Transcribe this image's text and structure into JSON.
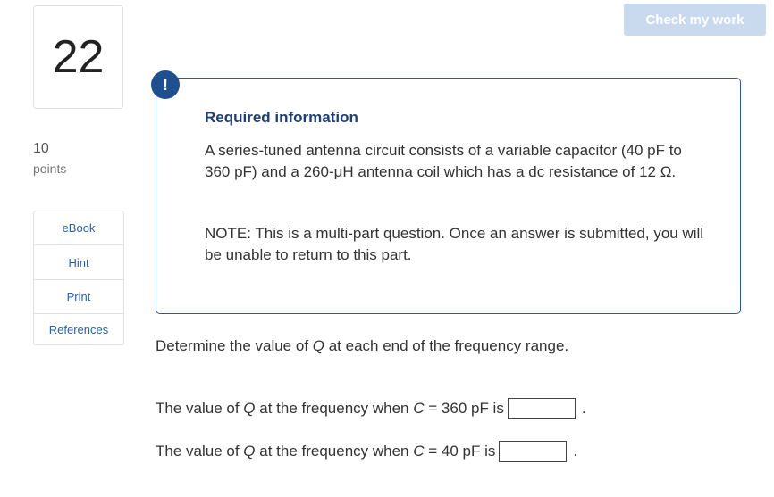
{
  "question": {
    "number": "22",
    "points_value": "10",
    "points_label": "points"
  },
  "tools": [
    {
      "label": "eBook"
    },
    {
      "label": "Hint"
    },
    {
      "label": "Print"
    },
    {
      "label": "References"
    }
  ],
  "header": {
    "check_button": "Check my work"
  },
  "info": {
    "icon": "!",
    "title": "Required information",
    "text": "A series-tuned antenna circuit consists of a variable capacitor (40 pF to 360 pF) and a 260-μH antenna coil which has a dc resistance of 12 Ω.",
    "note": "NOTE: This is a multi-part question. Once an answer is submitted, you will be unable to return to this part."
  },
  "prompt": {
    "prefix": "Determine the value of ",
    "var": "Q",
    "suffix": " at each end of the frequency range."
  },
  "answers": [
    {
      "prefix": "The value of ",
      "var": "Q",
      "middle": " at the frequency when ",
      "cvar": "C",
      "condition": " = 360 pF is",
      "value": "",
      "period": "."
    },
    {
      "prefix": "The value of ",
      "var": "Q",
      "middle": " at the frequency when ",
      "cvar": "C",
      "condition": " = 40 pF is",
      "value": "",
      "period": "."
    }
  ],
  "colors": {
    "accent": "#1f4f8f",
    "link": "#2b62a8",
    "button_disabled": "#c9d9ee",
    "border": "#2b5797"
  }
}
